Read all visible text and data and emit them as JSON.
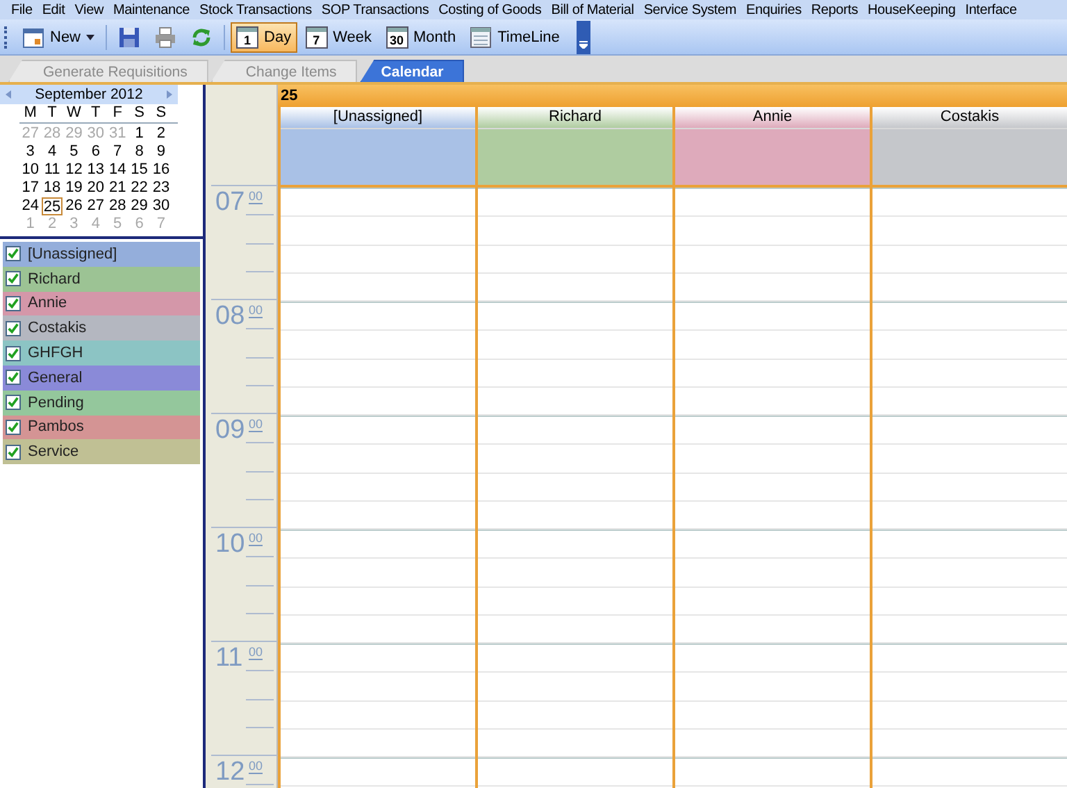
{
  "menu": [
    "File",
    "Edit",
    "View",
    "Maintenance",
    "Stock Transactions",
    "SOP Transactions",
    "Costing of Goods",
    "Bill of Material",
    "Service System",
    "Enquiries",
    "Reports",
    "HouseKeeping",
    "Interface"
  ],
  "toolbar": [
    {
      "kind": "new",
      "label": "New",
      "selected": false
    },
    {
      "kind": "save",
      "selected": false
    },
    {
      "kind": "print",
      "selected": false
    },
    {
      "kind": "refresh",
      "selected": false
    },
    {
      "kind": "view",
      "label": "Day",
      "icon_label": "1",
      "selected": true
    },
    {
      "kind": "view",
      "label": "Week",
      "icon_label": "7",
      "selected": false
    },
    {
      "kind": "view",
      "label": "Month",
      "icon_label": "30",
      "selected": false
    },
    {
      "kind": "timeline",
      "label": "TimeLine",
      "selected": false
    }
  ],
  "tabs": [
    {
      "label": "Generate Requisitions",
      "selected": false
    },
    {
      "label": "Change Items",
      "selected": false
    },
    {
      "label": "Calendar",
      "selected": true
    }
  ],
  "mini_calendar": {
    "title": "September 2012",
    "weekdays": [
      "M",
      "T",
      "W",
      "T",
      "F",
      "S",
      "S"
    ],
    "weeks": [
      [
        {
          "day": "27",
          "other_month": true,
          "selected": false
        },
        {
          "day": "28",
          "other_month": true,
          "selected": false
        },
        {
          "day": "29",
          "other_month": true,
          "selected": false
        },
        {
          "day": "30",
          "other_month": true,
          "selected": false
        },
        {
          "day": "31",
          "other_month": true,
          "selected": false
        },
        {
          "day": "1",
          "other_month": false,
          "selected": false
        },
        {
          "day": "2",
          "other_month": false,
          "selected": false
        }
      ],
      [
        {
          "day": "3",
          "other_month": false,
          "selected": false
        },
        {
          "day": "4",
          "other_month": false,
          "selected": false
        },
        {
          "day": "5",
          "other_month": false,
          "selected": false
        },
        {
          "day": "6",
          "other_month": false,
          "selected": false
        },
        {
          "day": "7",
          "other_month": false,
          "selected": false
        },
        {
          "day": "8",
          "other_month": false,
          "selected": false
        },
        {
          "day": "9",
          "other_month": false,
          "selected": false
        }
      ],
      [
        {
          "day": "10",
          "other_month": false,
          "selected": false
        },
        {
          "day": "11",
          "other_month": false,
          "selected": false
        },
        {
          "day": "12",
          "other_month": false,
          "selected": false
        },
        {
          "day": "13",
          "other_month": false,
          "selected": false
        },
        {
          "day": "14",
          "other_month": false,
          "selected": false
        },
        {
          "day": "15",
          "other_month": false,
          "selected": false
        },
        {
          "day": "16",
          "other_month": false,
          "selected": false
        }
      ],
      [
        {
          "day": "17",
          "other_month": false,
          "selected": false
        },
        {
          "day": "18",
          "other_month": false,
          "selected": false
        },
        {
          "day": "19",
          "other_month": false,
          "selected": false
        },
        {
          "day": "20",
          "other_month": false,
          "selected": false
        },
        {
          "day": "21",
          "other_month": false,
          "selected": false
        },
        {
          "day": "22",
          "other_month": false,
          "selected": false
        },
        {
          "day": "23",
          "other_month": false,
          "selected": false
        }
      ],
      [
        {
          "day": "24",
          "other_month": false,
          "selected": false
        },
        {
          "day": "25",
          "other_month": false,
          "selected": true
        },
        {
          "day": "26",
          "other_month": false,
          "selected": false
        },
        {
          "day": "27",
          "other_month": false,
          "selected": false
        },
        {
          "day": "28",
          "other_month": false,
          "selected": false
        },
        {
          "day": "29",
          "other_month": false,
          "selected": false
        },
        {
          "day": "30",
          "other_month": false,
          "selected": false
        }
      ],
      [
        {
          "day": "1",
          "other_month": true,
          "selected": false
        },
        {
          "day": "2",
          "other_month": true,
          "selected": false
        },
        {
          "day": "3",
          "other_month": true,
          "selected": false
        },
        {
          "day": "4",
          "other_month": true,
          "selected": false
        },
        {
          "day": "5",
          "other_month": true,
          "selected": false
        },
        {
          "day": "6",
          "other_month": true,
          "selected": false
        },
        {
          "day": "7",
          "other_month": true,
          "selected": false
        }
      ]
    ]
  },
  "resources": [
    {
      "name": "[Unassigned]",
      "checked": true,
      "color": "#94aedb"
    },
    {
      "name": "Richard",
      "checked": true,
      "color": "#9cc394"
    },
    {
      "name": "Annie",
      "checked": true,
      "color": "#d497a9"
    },
    {
      "name": "Costakis",
      "checked": true,
      "color": "#b4b7c0"
    },
    {
      "name": "GHFGH",
      "checked": true,
      "color": "#8cc4c4"
    },
    {
      "name": "General",
      "checked": true,
      "color": "#8a8ad8"
    },
    {
      "name": "Pending",
      "checked": true,
      "color": "#94c79c"
    },
    {
      "name": "Pambos",
      "checked": true,
      "color": "#d49494"
    },
    {
      "name": "Service",
      "checked": true,
      "color": "#c0c094"
    }
  ],
  "day_header": "25",
  "columns": [
    {
      "name": "[Unassigned]",
      "color": "#a9c1e6"
    },
    {
      "name": "Richard",
      "color": "#afcca0"
    },
    {
      "name": "Annie",
      "color": "#deaabb"
    },
    {
      "name": "Costakis",
      "color": "#c5c7cb"
    }
  ],
  "hours": [
    {
      "hour": "07",
      "minutes": "00"
    },
    {
      "hour": "08",
      "minutes": "00"
    },
    {
      "hour": "09",
      "minutes": "00"
    },
    {
      "hour": "10",
      "minutes": "00"
    },
    {
      "hour": "11",
      "minutes": "00"
    },
    {
      "hour": "12",
      "minutes": "00"
    }
  ]
}
